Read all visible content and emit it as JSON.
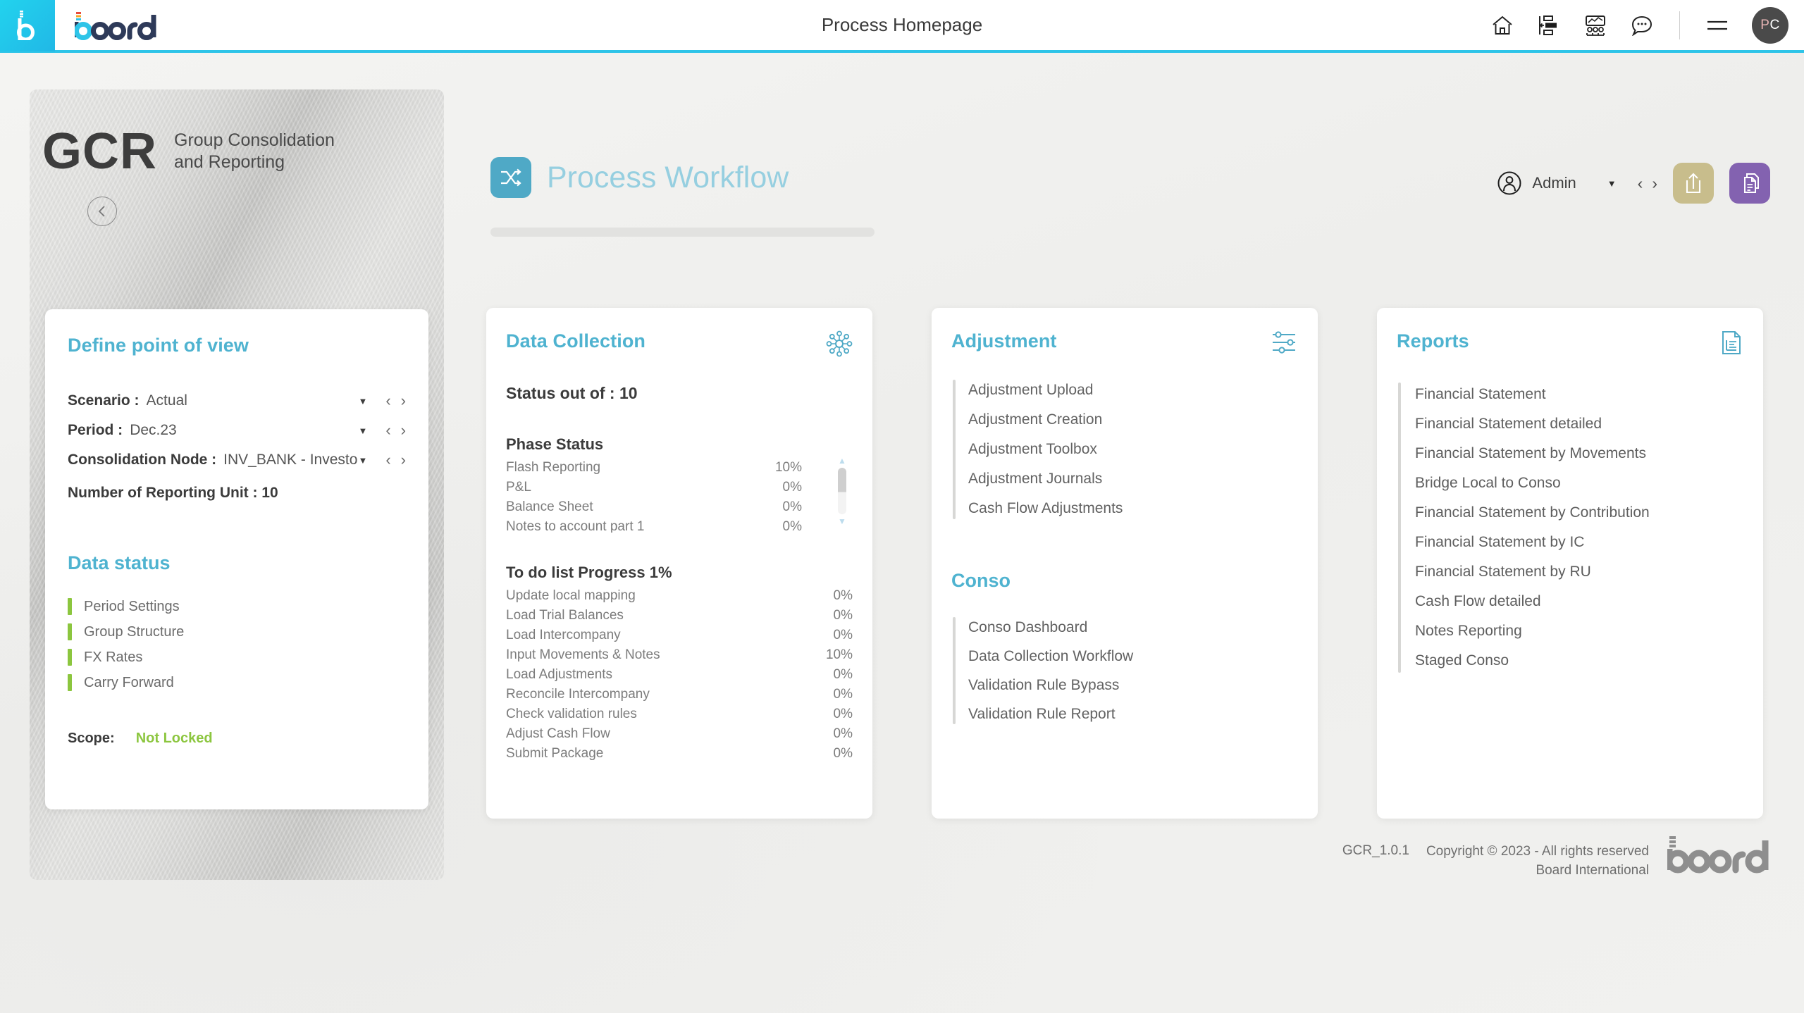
{
  "topbar": {
    "title": "Process Homepage",
    "brand": "board",
    "icons": [
      {
        "name": "home-icon",
        "label": "Home"
      },
      {
        "name": "layout-panel-icon",
        "label": "Layout"
      },
      {
        "name": "presentation-audience-icon",
        "label": "Presentation"
      },
      {
        "name": "chat-bubble-icon",
        "label": "Chat"
      },
      {
        "name": "hamburger-menu-icon",
        "label": "Menu"
      }
    ],
    "avatar": {
      "initial_1": "P",
      "initial_2": "C"
    },
    "accent_color": "#2ec4e8"
  },
  "sidebar": {
    "acronym": "GCR",
    "subtitle_line1": "Group Consolidation",
    "subtitle_line2": "and Reporting",
    "collapse_icon": "chevron-left-icon",
    "point_of_view": {
      "title": "Define point of view",
      "rows": [
        {
          "label": "Scenario :",
          "value": "Actual"
        },
        {
          "label": "Period :",
          "value": "Dec.23"
        },
        {
          "label": "Consolidation Node :",
          "value": "INV_BANK - Investors &"
        }
      ],
      "static_row": "Number of Reporting Unit : 10"
    },
    "data_status": {
      "title": "Data status",
      "marker_color": "#8cc63f",
      "items": [
        {
          "label": "Period Settings"
        },
        {
          "label": "Group Structure"
        },
        {
          "label": "FX Rates"
        },
        {
          "label": "Carry Forward"
        }
      ],
      "scope_label": "Scope:",
      "scope_value": "Not Locked",
      "scope_color": "#8cc63f"
    }
  },
  "main": {
    "page_title": "Process Workflow",
    "page_icon": "shuffle-arrows-icon",
    "admin": {
      "icon": "user-circle-icon",
      "name": "Admin",
      "caret": "▼",
      "prev": "‹",
      "next": "›"
    },
    "actions": [
      {
        "name": "export-share-button",
        "icon": "share-upload-icon",
        "color": "#c8bd8c"
      },
      {
        "name": "documents-button",
        "icon": "documents-copy-icon",
        "color": "#8362b0"
      }
    ],
    "cards": {
      "data_collection": {
        "title": "Data Collection",
        "icon": "network-hub-icon",
        "status_line": "Status out of : 10",
        "phase_status": {
          "title": "Phase Status",
          "rows": [
            {
              "label": "Flash Reporting",
              "value": "10%"
            },
            {
              "label": "P&L",
              "value": "0%"
            },
            {
              "label": "Balance Sheet",
              "value": "0%"
            },
            {
              "label": "Notes to account part 1",
              "value": "0%"
            }
          ]
        },
        "todo": {
          "title": "To do list Progress 1%",
          "rows": [
            {
              "label": "Update local mapping",
              "value": "0%"
            },
            {
              "label": "Load Trial Balances",
              "value": "0%"
            },
            {
              "label": "Load Intercompany",
              "value": "0%"
            },
            {
              "label": "Input Movements & Notes",
              "value": "10%"
            },
            {
              "label": "Load Adjustments",
              "value": "0%"
            },
            {
              "label": "Reconcile Intercompany",
              "value": "0%"
            },
            {
              "label": "Check validation rules",
              "value": "0%"
            },
            {
              "label": "Adjust Cash Flow",
              "value": "0%"
            },
            {
              "label": "Submit Package",
              "value": "0%"
            }
          ]
        }
      },
      "adjustment": {
        "title": "Adjustment",
        "icon": "sliders-icon",
        "links": [
          {
            "label": "Adjustment Upload"
          },
          {
            "label": "Adjustment Creation"
          },
          {
            "label": "Adjustment Toolbox"
          },
          {
            "label": "Adjustment Journals"
          },
          {
            "label": "Cash Flow Adjustments"
          }
        ],
        "conso": {
          "title": "Conso",
          "links": [
            {
              "label": "Conso Dashboard"
            },
            {
              "label": "Data Collection Workflow"
            },
            {
              "label": "Validation Rule Bypass"
            },
            {
              "label": "Validation Rule Report"
            }
          ]
        }
      },
      "reports": {
        "title": "Reports",
        "icon": "document-report-icon",
        "links": [
          {
            "label": "Financial Statement"
          },
          {
            "label": "Financial Statement detailed"
          },
          {
            "label": "Financial Statement by Movements"
          },
          {
            "label": "Bridge Local to Conso"
          },
          {
            "label": "Financial Statement by Contribution"
          },
          {
            "label": "Financial Statement by IC"
          },
          {
            "label": "Financial Statement by RU"
          },
          {
            "label": "Cash Flow detailed"
          },
          {
            "label": "Notes Reporting"
          },
          {
            "label": "Staged Conso"
          }
        ]
      }
    }
  },
  "footer": {
    "version": "GCR_1.0.1",
    "copyright_line1": "Copyright © 2023 - All rights reserved",
    "copyright_line2": "Board International",
    "logo": "board"
  }
}
